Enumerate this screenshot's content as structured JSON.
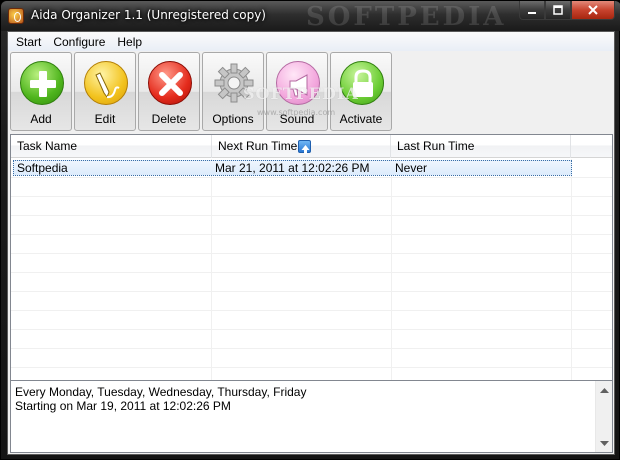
{
  "window": {
    "title": "Aida Organizer 1.1 (Unregistered copy)",
    "watermark": "SOFTPEDIA"
  },
  "menu": [
    "Start",
    "Configure",
    "Help"
  ],
  "toolbar": {
    "buttons": [
      {
        "label": "Add",
        "icon": "plus-icon"
      },
      {
        "label": "Edit",
        "icon": "pencil-icon"
      },
      {
        "label": "Delete",
        "icon": "x-icon"
      },
      {
        "label": "Options",
        "icon": "gear-icon"
      },
      {
        "label": "Sound",
        "icon": "megaphone-icon"
      },
      {
        "label": "Activate",
        "icon": "lock-icon"
      }
    ],
    "watermark": "SOFTPEDIA",
    "watermark_small": "www.softpedia.com"
  },
  "list": {
    "columns": [
      "Task Name",
      "Next Run Time",
      "Last Run Time"
    ],
    "rows": [
      {
        "task": "Softpedia",
        "next": "Mar 21, 2011 at 12:02:26 PM",
        "last": "Never"
      }
    ]
  },
  "detail": {
    "line1": "Every Monday, Tuesday, Wednesday, Thursday, Friday",
    "line2": "Starting on Mar 19, 2011 at 12:02:26 PM"
  },
  "colors": {
    "selection": "#dcebfc",
    "accent": "#3a6ea5"
  }
}
